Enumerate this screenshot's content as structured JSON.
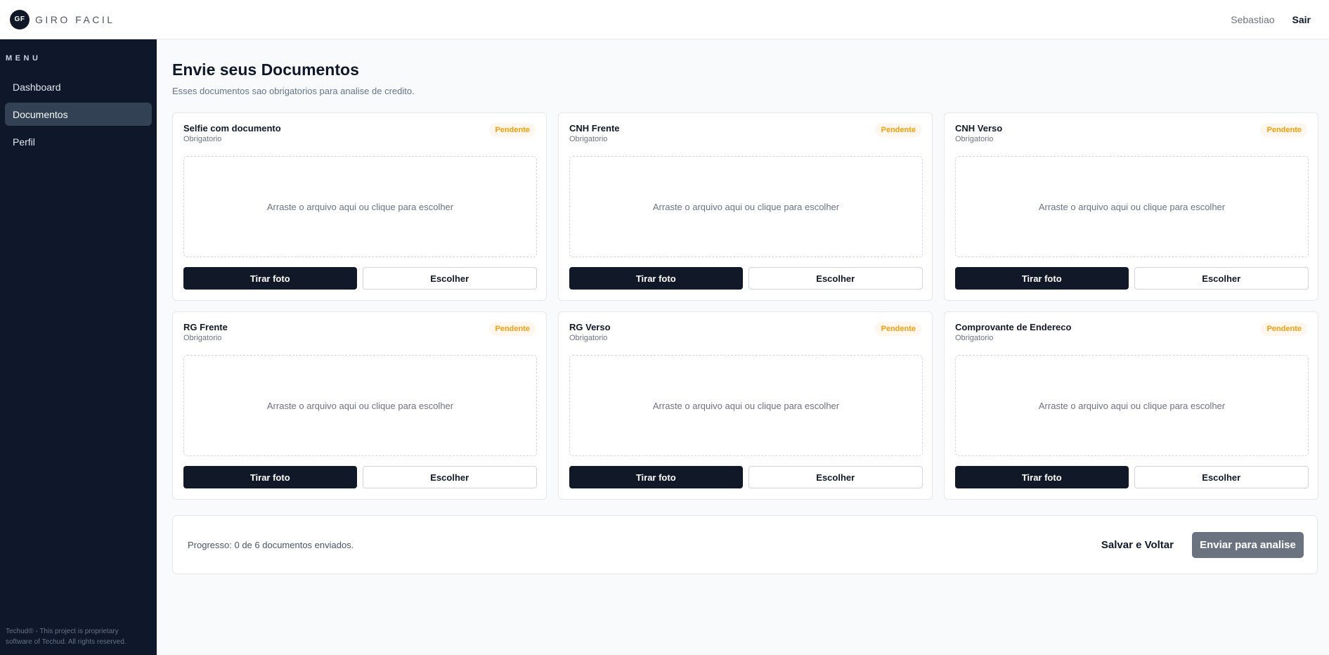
{
  "header": {
    "logo_mark": "GF",
    "app_name": "GIRO FACIL",
    "user_name": "Sebastiao",
    "logout_label": "Sair"
  },
  "sidebar": {
    "menu_title": "MENU",
    "items": [
      {
        "label": "Dashboard",
        "active": false
      },
      {
        "label": "Documentos",
        "active": true
      },
      {
        "label": "Perfil",
        "active": false
      }
    ],
    "footer": "Techud® - This project is proprietary software of Techud. All rights reserved."
  },
  "main": {
    "title": "Envie seus Documentos",
    "subtitle": "Esses documentos sao obrigatorios para analise de credito.",
    "cards": [
      {
        "title": "Selfie com documento",
        "subtitle": "Obrigatorio",
        "status": "Pendente",
        "dropzone": "Arraste o arquivo aqui ou clique para escolher",
        "photo_label": "Tirar foto",
        "choose_label": "Escolher"
      },
      {
        "title": "CNH Frente",
        "subtitle": "Obrigatorio",
        "status": "Pendente",
        "dropzone": "Arraste o arquivo aqui ou clique para escolher",
        "photo_label": "Tirar foto",
        "choose_label": "Escolher"
      },
      {
        "title": "CNH Verso",
        "subtitle": "Obrigatorio",
        "status": "Pendente",
        "dropzone": "Arraste o arquivo aqui ou clique para escolher",
        "photo_label": "Tirar foto",
        "choose_label": "Escolher"
      },
      {
        "title": "RG Frente",
        "subtitle": "Obrigatorio",
        "status": "Pendente",
        "dropzone": "Arraste o arquivo aqui ou clique para escolher",
        "photo_label": "Tirar foto",
        "choose_label": "Escolher"
      },
      {
        "title": "RG Verso",
        "subtitle": "Obrigatorio",
        "status": "Pendente",
        "dropzone": "Arraste o arquivo aqui ou clique para escolher",
        "photo_label": "Tirar foto",
        "choose_label": "Escolher"
      },
      {
        "title": "Comprovante de Endereco",
        "subtitle": "Obrigatorio",
        "status": "Pendente",
        "dropzone": "Arraste o arquivo aqui ou clique para escolher",
        "photo_label": "Tirar foto",
        "choose_label": "Escolher"
      }
    ],
    "progress_text": "Progresso: 0 de 6 documentos enviados.",
    "save_back_label": "Salvar e Voltar",
    "submit_label": "Enviar para analise"
  },
  "colors": {
    "sidebar_bg": "#0f172a",
    "primary_button": "#111827",
    "pending_badge_text": "#f59e0b",
    "pending_badge_bg": "#fff7ed",
    "disabled_button": "#6b7280"
  }
}
